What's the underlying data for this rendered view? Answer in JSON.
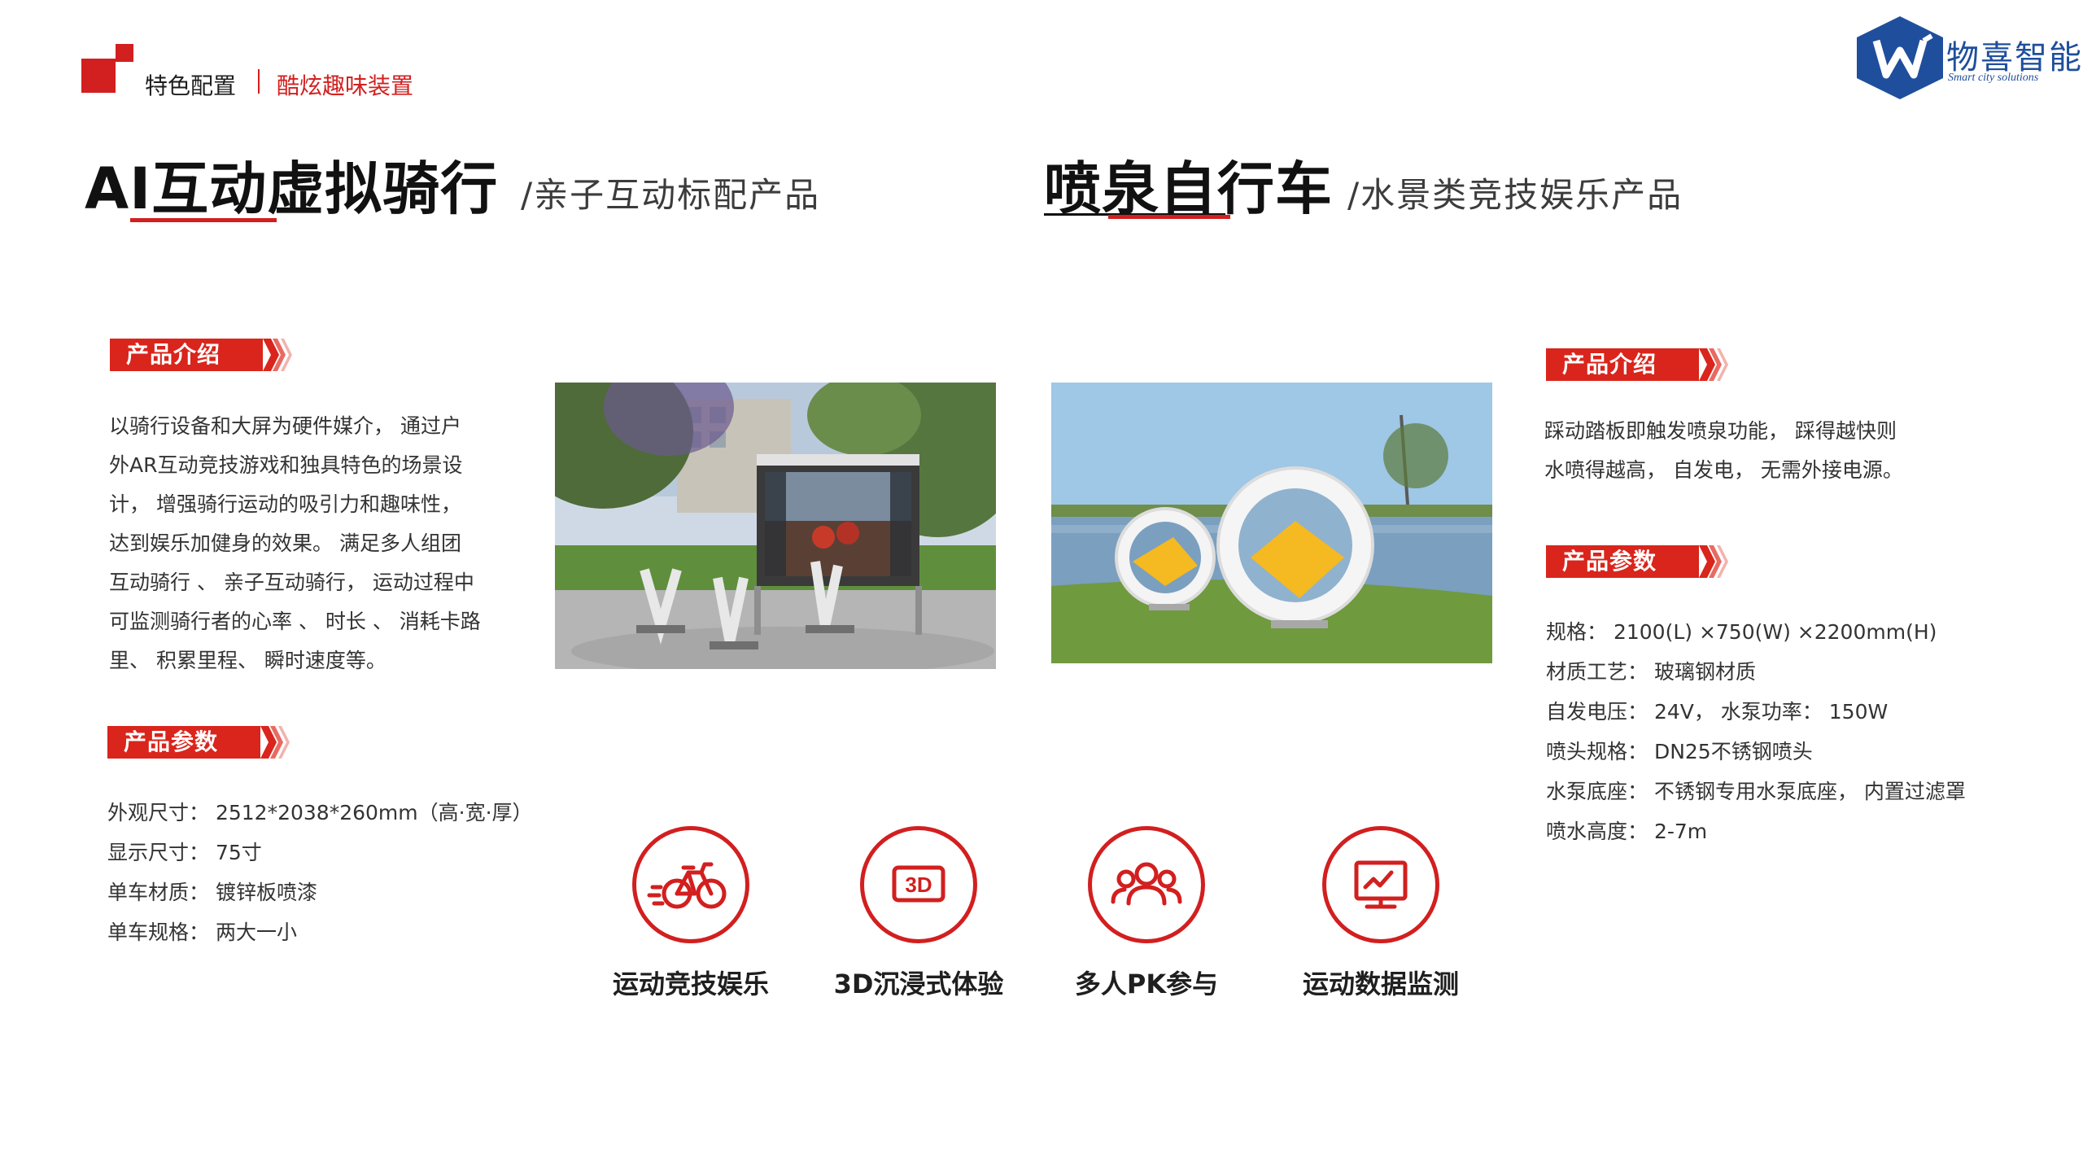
{
  "header": {
    "section": "特色配置",
    "subtitle": "酷炫趣味装置"
  },
  "logo": {
    "name_cn": "物喜智能",
    "name_en": "Smart city solutions"
  },
  "product_left": {
    "title": "AI互动虚拟骑行",
    "subtitle": "/亲子互动标配产品",
    "intro_label": "产品介绍",
    "intro_lines": [
      "以骑行设备和大屏为硬件媒介， 通过户",
      "外AR互动竞技游戏和独具特色的场景设",
      "计， 增强骑行运动的吸引力和趣味性，",
      "达到娱乐加健身的效果。 满足多人组团",
      "互动骑行 、 亲子互动骑行， 运动过程中",
      "可监测骑行者的心率 、 时长 、 消耗卡路",
      "里、 积累里程、  瞬时速度等。"
    ],
    "params_label": "产品参数",
    "params": [
      "外观尺寸： 2512*2038*260mm（高·宽·厚）",
      "显示尺寸： 75寸",
      "单车材质： 镀锌板喷漆",
      "单车规格： 两大一小"
    ]
  },
  "product_right": {
    "title": "喷泉自行车",
    "subtitle": "/水景类竞技娱乐产品",
    "intro_label": "产品介绍",
    "intro_lines": [
      "踩动踏板即触发喷泉功能， 踩得越快则",
      "水喷得越高， 自发电， 无需外接电源。"
    ],
    "params_label": "产品参数",
    "params": [
      "规格： 2100(L) ×750(W) ×2200mm(H)",
      "材质工艺： 玻璃钢材质",
      "自发电压： 24V， 水泵功率： 150W",
      "喷头规格： DN25不锈钢喷头",
      "水泵底座： 不锈钢专用水泵底座， 内置过滤罩",
      "喷水高度： 2-7m"
    ]
  },
  "features": [
    {
      "label": "运动竞技娱乐",
      "icon": "bicycle-icon"
    },
    {
      "label": "3D沉浸式体验",
      "icon": "3d-icon"
    },
    {
      "label": "多人PK参与",
      "icon": "group-icon"
    },
    {
      "label": "运动数据监测",
      "icon": "monitor-chart-icon"
    }
  ],
  "colors": {
    "accent": "#d21f1f",
    "logo_blue": "#1f4f9c"
  },
  "icons": [
    "bicycle-icon",
    "3d-icon",
    "group-icon",
    "monitor-chart-icon",
    "logo-hexagon-icon"
  ]
}
